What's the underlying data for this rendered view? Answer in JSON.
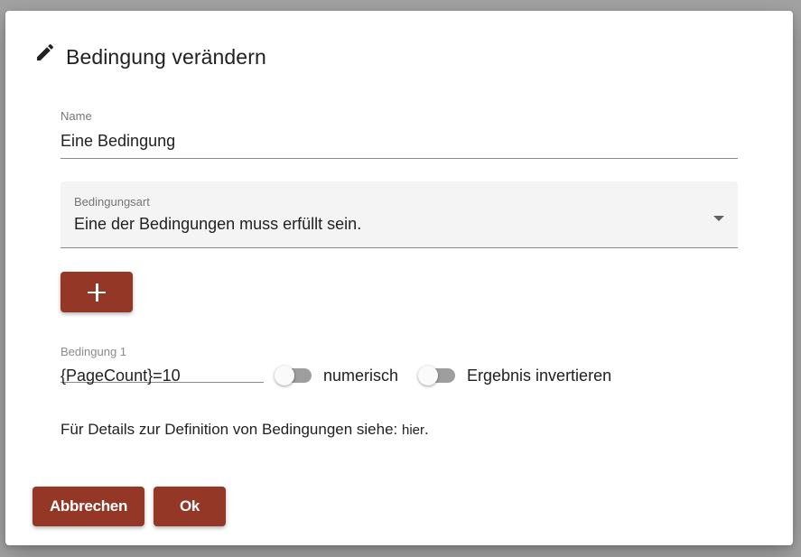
{
  "dialog": {
    "title": "Bedingung verändern",
    "title_icon": "pencil-icon"
  },
  "name_field": {
    "label": "Name",
    "value": "Eine Bedingung"
  },
  "condition_type": {
    "label": "Bedingungsart",
    "selected": "Eine der Bedingungen muss erfüllt sein.",
    "icon": "dropdown-arrow-icon"
  },
  "add_button": {
    "icon": "plus-icon"
  },
  "conditions": [
    {
      "label": "Bedingung 1",
      "value": "{PageCount}=10",
      "numeric_label": "numerisch",
      "numeric_on": false,
      "invert_label": "Ergebnis invertieren",
      "invert_on": false
    }
  ],
  "details": {
    "text": "Für Details zur Definition von Bedingungen siehe: ",
    "link": "hier",
    "suffix": "."
  },
  "footer": {
    "cancel_label": "Abbrechen",
    "ok_label": "Ok"
  },
  "colors": {
    "accent": "#943726",
    "field_background": "#f4f4f4",
    "overlay": "#a3a3a3"
  }
}
